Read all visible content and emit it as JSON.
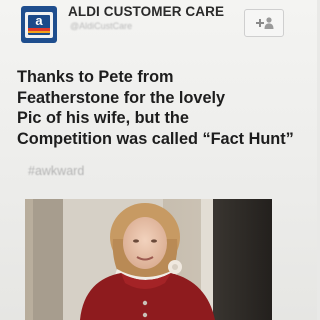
{
  "tweet": {
    "author_name": "ALDI CUSTOMER CARE",
    "handle": "@AldiCustCare",
    "follow_icon": "follow-plus-icon",
    "text_lines": [
      "Thanks to Pete from",
      "Featherstone for the lovely",
      "Pic of his wife, but the",
      "Competition was called “Fact Hunt”"
    ],
    "hashtag": "#awkward"
  },
  "colors": {
    "brand_blue": "#1f4e8e",
    "brand_red": "#e0382b",
    "brand_orange": "#f2a21b"
  }
}
